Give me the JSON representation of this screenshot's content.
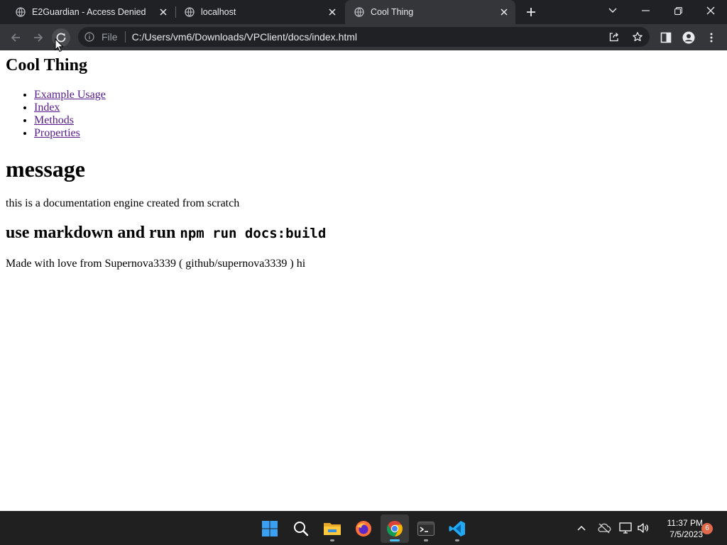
{
  "browser": {
    "tabs": [
      {
        "title": "E2Guardian - Access Denied",
        "active": false
      },
      {
        "title": "localhost",
        "active": false
      },
      {
        "title": "Cool Thing",
        "active": true
      }
    ],
    "address": {
      "scheme_label": "File",
      "url": "C:/Users/vm6/Downloads/VPClient/docs/index.html"
    }
  },
  "page": {
    "site_title": "Cool Thing",
    "nav_links": [
      "Example Usage",
      "Index",
      "Methods",
      "Properties"
    ],
    "message_heading": "message",
    "description": "this is a documentation engine created from scratch",
    "markdown_heading": "use markdown and run",
    "markdown_command": "npm run docs:build",
    "credit": "Made with love from Supernova3339 ( github/supernova3339 ) hi"
  },
  "taskbar": {
    "apps": [
      "start-icon",
      "search-icon",
      "file-explorer-icon",
      "firefox-icon",
      "chrome-icon",
      "terminal-icon",
      "vscode-icon"
    ],
    "clock_time": "11:37 PM",
    "clock_date": "7/5/2023",
    "notification_count": "6"
  },
  "colors": {
    "tab_bar": "#202124",
    "toolbar": "#35363a",
    "link_visited": "#551a8b",
    "taskbar": "#202020",
    "active_indicator": "#4cc2ff"
  }
}
